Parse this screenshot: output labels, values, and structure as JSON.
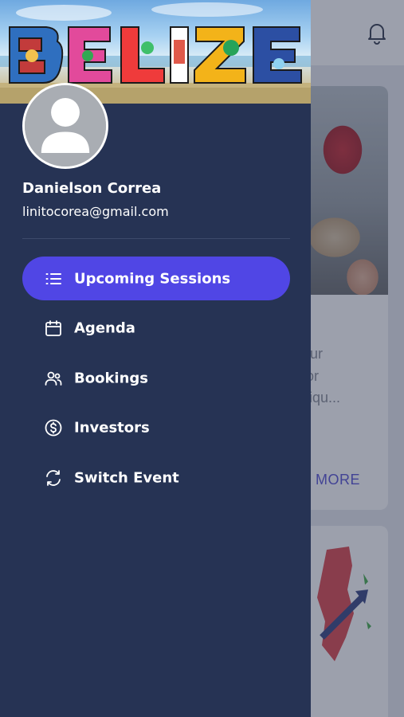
{
  "drawer": {
    "user": {
      "name": "Danielson Correa",
      "email": "linitocorea@gmail.com"
    },
    "menu": [
      {
        "label": "Upcoming Sessions",
        "icon": "list-icon",
        "active": true
      },
      {
        "label": "Agenda",
        "icon": "calendar-icon",
        "active": false
      },
      {
        "label": "Bookings",
        "icon": "users-icon",
        "active": false
      },
      {
        "label": "Investors",
        "icon": "dollar-circle-icon",
        "active": false
      },
      {
        "label": "Switch Event",
        "icon": "refresh-icon",
        "active": false
      }
    ]
  },
  "background": {
    "card_text_lines": [
      "etur",
      "oor",
      "aliqu..."
    ],
    "card_action": "MORE"
  },
  "colors": {
    "drawer_bg": "#263354",
    "active_item": "#5046e5",
    "accent_text": "#5b57d6"
  }
}
